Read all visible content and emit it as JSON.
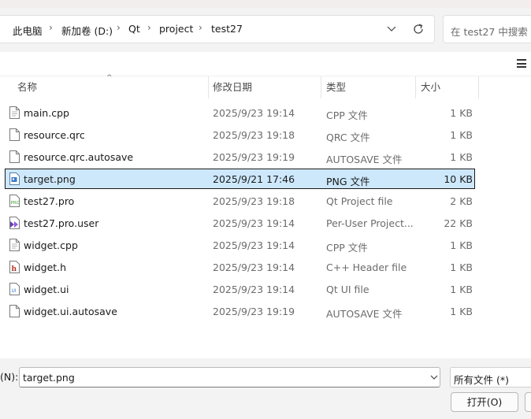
{
  "address_bar": {
    "breadcrumbs": [
      {
        "label": "此电脑"
      },
      {
        "label": "新加卷 (D:)"
      },
      {
        "label": "Qt"
      },
      {
        "label": "project"
      },
      {
        "label": "test27"
      }
    ]
  },
  "search": {
    "placeholder": "在 test27 中搜索"
  },
  "columns": {
    "name": "名称",
    "modified": "修改日期",
    "type": "类型",
    "size": "大小"
  },
  "files": [
    {
      "name": "main.cpp",
      "modified": "2025/9/23 19:14",
      "type": "CPP 文件",
      "size": "1 KB",
      "icon": "cpp-file-icon"
    },
    {
      "name": "resource.qrc",
      "modified": "2025/9/23 19:18",
      "type": "QRC 文件",
      "size": "1 KB",
      "icon": "qrc-file-icon"
    },
    {
      "name": "resource.qrc.autosave",
      "modified": "2025/9/23 19:19",
      "type": "AUTOSAVE 文件",
      "size": "1 KB",
      "icon": "autosave-file-icon"
    },
    {
      "name": "target.png",
      "modified": "2025/9/21 17:46",
      "type": "PNG 文件",
      "size": "10 KB",
      "icon": "png-file-icon",
      "selected": true
    },
    {
      "name": "test27.pro",
      "modified": "2025/9/23 19:18",
      "type": "Qt Project file",
      "size": "2 KB",
      "icon": "qt-project-file-icon"
    },
    {
      "name": "test27.pro.user",
      "modified": "2025/9/23 19:14",
      "type": "Per-User Project...",
      "size": "22 KB",
      "icon": "pro-user-file-icon"
    },
    {
      "name": "widget.cpp",
      "modified": "2025/9/23 19:14",
      "type": "CPP 文件",
      "size": "1 KB",
      "icon": "cpp-file-icon"
    },
    {
      "name": "widget.h",
      "modified": "2025/9/23 19:14",
      "type": "C++ Header file",
      "size": "1 KB",
      "icon": "header-file-icon"
    },
    {
      "name": "widget.ui",
      "modified": "2025/9/23 19:14",
      "type": "Qt UI file",
      "size": "1 KB",
      "icon": "ui-file-icon"
    },
    {
      "name": "widget.ui.autosave",
      "modified": "2025/9/23 19:19",
      "type": "AUTOSAVE 文件",
      "size": "1 KB",
      "icon": "autosave-file-icon"
    }
  ],
  "footer": {
    "filename_label": "(N):",
    "filename_value": "target.png",
    "filter_value": "所有文件 (*)",
    "open_label": "打开(O)"
  },
  "colors": {
    "selection_bg": "#cde8fb",
    "chrome_bg": "#f3f3f3"
  }
}
